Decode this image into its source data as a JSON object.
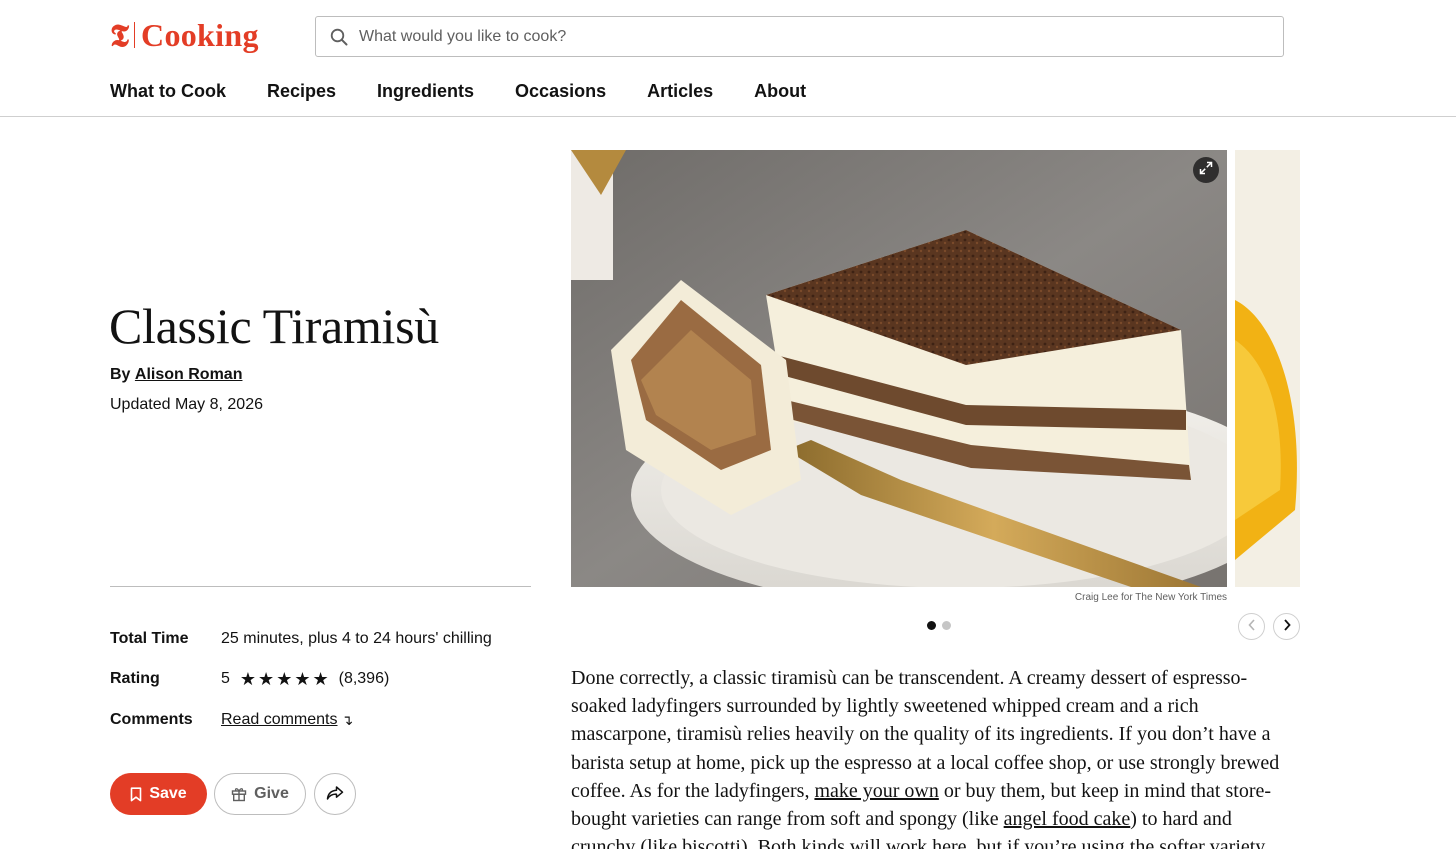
{
  "brand": {
    "t_glyph": "𝕿",
    "name": "Cooking",
    "color": "#e33d26"
  },
  "search": {
    "placeholder": "What would you like to cook?"
  },
  "nav": [
    {
      "label": "What to Cook"
    },
    {
      "label": "Recipes"
    },
    {
      "label": "Ingredients"
    },
    {
      "label": "Occasions"
    },
    {
      "label": "Articles"
    },
    {
      "label": "About"
    }
  ],
  "recipe": {
    "title": "Classic Tiramisù",
    "by_prefix": "By",
    "author": "Alison Roman",
    "updated": "Updated May 8, 2026"
  },
  "meta": {
    "total_time_label": "Total Time",
    "total_time_value": "25 minutes, plus 4 to 24 hours' chilling",
    "rating_label": "Rating",
    "rating_value": "5",
    "rating_stars": 5,
    "rating_count": "(8,396)",
    "comments_label": "Comments",
    "comments_link": "Read comments",
    "comments_arrow": "↴"
  },
  "actions": {
    "save_label": "Save",
    "give_label": "Give"
  },
  "gallery": {
    "credit": "Craig Lee for The New York Times",
    "active_slide": 1,
    "total_slides": 2
  },
  "description": {
    "p1": "Done correctly, a classic tiramisù can be transcendent. A creamy dessert of espresso-soaked ladyfingers surrounded by lightly sweetened whipped cream and a rich mascarpone, tiramisù relies heavily on the quality of its ingredients. If you don’t have a barista setup at home, pick up the espresso at a local coffee shop, or use strongly brewed coffee. As for the ladyfingers, ",
    "link1": "make your own",
    "p2": " or buy them, but keep in mind that store-bought varieties can range from soft and spongy (like ",
    "link2": "angel food cake",
    "p3": ") to hard and crunchy (like ",
    "link3": "biscotti",
    "p4": "). Both kinds will work here, but if you’re using the softer variety, stick to a light brushing of"
  }
}
